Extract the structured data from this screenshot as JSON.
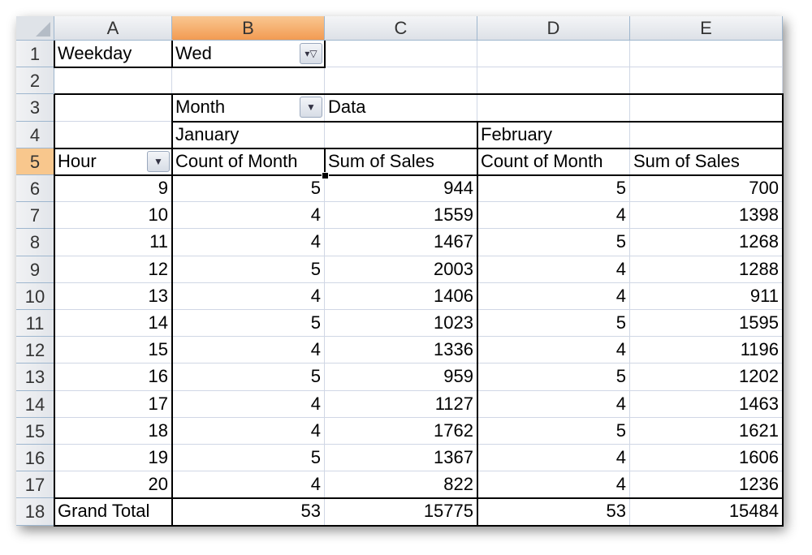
{
  "columns": [
    "A",
    "B",
    "C",
    "D",
    "E"
  ],
  "selected_column": "B",
  "selected_row": 5,
  "rows": [
    {
      "n": "1",
      "cells": [
        "Weekday",
        "Wed",
        "",
        "",
        ""
      ]
    },
    {
      "n": "2",
      "cells": [
        "",
        "",
        "",
        "",
        ""
      ]
    },
    {
      "n": "3",
      "cells": [
        "",
        "Month",
        "Data",
        "",
        ""
      ]
    },
    {
      "n": "4",
      "cells": [
        "",
        "January",
        "",
        "February",
        ""
      ]
    },
    {
      "n": "5",
      "cells": [
        "Hour",
        "Count of Month",
        "Sum of Sales",
        "Count of Month",
        "Sum of Sales"
      ]
    },
    {
      "n": "6",
      "cells": [
        "9",
        "5",
        "944",
        "5",
        "700"
      ]
    },
    {
      "n": "7",
      "cells": [
        "10",
        "4",
        "1559",
        "4",
        "1398"
      ]
    },
    {
      "n": "8",
      "cells": [
        "11",
        "4",
        "1467",
        "5",
        "1268"
      ]
    },
    {
      "n": "9",
      "cells": [
        "12",
        "5",
        "2003",
        "4",
        "1288"
      ]
    },
    {
      "n": "10",
      "cells": [
        "13",
        "4",
        "1406",
        "4",
        "911"
      ]
    },
    {
      "n": "11",
      "cells": [
        "14",
        "5",
        "1023",
        "5",
        "1595"
      ]
    },
    {
      "n": "12",
      "cells": [
        "15",
        "4",
        "1336",
        "4",
        "1196"
      ]
    },
    {
      "n": "13",
      "cells": [
        "16",
        "5",
        "959",
        "5",
        "1202"
      ]
    },
    {
      "n": "14",
      "cells": [
        "17",
        "4",
        "1127",
        "4",
        "1463"
      ]
    },
    {
      "n": "15",
      "cells": [
        "18",
        "4",
        "1762",
        "5",
        "1621"
      ]
    },
    {
      "n": "16",
      "cells": [
        "19",
        "5",
        "1367",
        "4",
        "1606"
      ]
    },
    {
      "n": "17",
      "cells": [
        "20",
        "4",
        "822",
        "4",
        "1236"
      ]
    },
    {
      "n": "18",
      "cells": [
        "Grand Total",
        "53",
        "15775",
        "53",
        "15484"
      ]
    }
  ],
  "dropdowns": [
    {
      "field": "Weekday",
      "icon": "filter-dropdown-icon"
    },
    {
      "field": "Month",
      "icon": "chevron-down-icon"
    },
    {
      "field": "Hour",
      "icon": "chevron-down-icon"
    }
  ]
}
